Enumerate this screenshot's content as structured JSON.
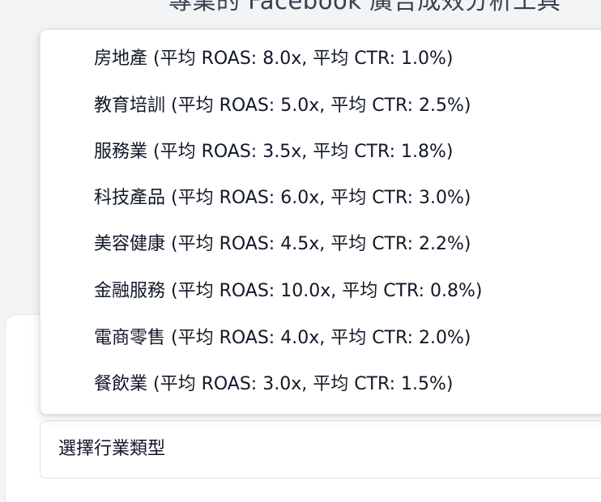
{
  "page": {
    "title": "專業的 Facebook 廣告成效分析工具"
  },
  "industry_select": {
    "placeholder": "選擇行業類型",
    "options": [
      {
        "label": "房地產 (平均 ROAS: 8.0x, 平均 CTR: 1.0%)"
      },
      {
        "label": "教育培訓 (平均 ROAS: 5.0x, 平均 CTR: 2.5%)"
      },
      {
        "label": "服務業 (平均 ROAS: 3.5x, 平均 CTR: 1.8%)"
      },
      {
        "label": "科技產品 (平均 ROAS: 6.0x, 平均 CTR: 3.0%)"
      },
      {
        "label": "美容健康 (平均 ROAS: 4.5x, 平均 CTR: 2.2%)"
      },
      {
        "label": "金融服務 (平均 ROAS: 10.0x, 平均 CTR: 0.8%)"
      },
      {
        "label": "電商零售 (平均 ROAS: 4.0x, 平均 CTR: 2.0%)"
      },
      {
        "label": "餐飲業 (平均 ROAS: 3.0x, 平均 CTR: 1.5%)"
      }
    ]
  }
}
